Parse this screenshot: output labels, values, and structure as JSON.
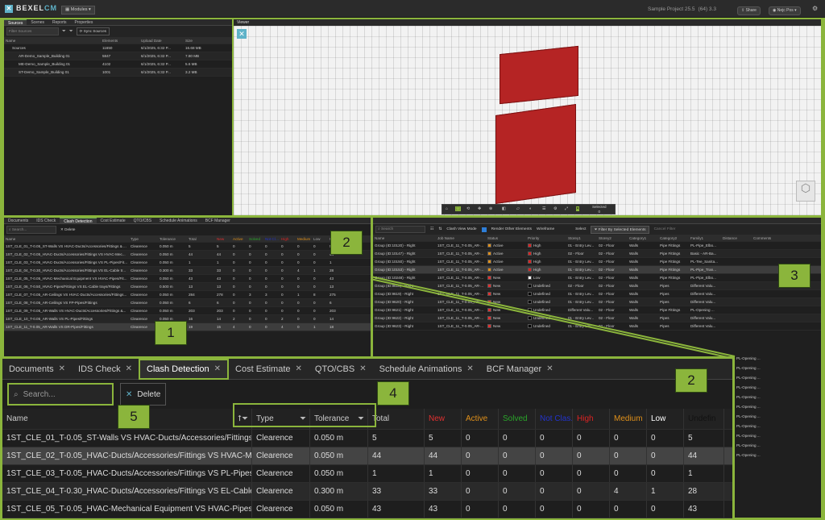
{
  "app": {
    "brand_a": "BEXEL",
    "brand_b": "CM",
    "modules": "Modules",
    "project": "Sample Project 25.5",
    "project_meta": "(64) 3.3",
    "share": "Share",
    "user": "Nejc Pos"
  },
  "left_panel": {
    "tabs": [
      "Sources",
      "Scenes",
      "Reports",
      "Properties"
    ],
    "filter_placeholder": "Filter Sources",
    "sync": "Sync Sources",
    "headers": [
      "Name",
      "Elements",
      "Upload Date",
      "Size"
    ],
    "rows": [
      [
        "Sources",
        "11650",
        "6/1/2025, 6:32 P...",
        "16.68 MB"
      ],
      [
        "AR-Demo_Sample_Building 01",
        "5847",
        "6/1/2025, 6:32 P...",
        "7.80 MB"
      ],
      [
        "ME-Demo_Sample_Building 01",
        "4102",
        "6/1/2025, 6:32 P...",
        "5.6 MB"
      ],
      [
        "ST-Demo_Sample_Building 01",
        "1001",
        "6/1/2025, 6:32 P...",
        "3.2 MB"
      ]
    ]
  },
  "viewer": {
    "title": "Viewer",
    "selected_label": "Selected",
    "selected_count": "0"
  },
  "small_clash": {
    "tabs": [
      "Documents",
      "IDS Check",
      "Clash Detection",
      "Cost Estimate",
      "QTO/CBS",
      "Schedule Animations",
      "BCF Manager"
    ],
    "search": "Search...",
    "delete": "Delete",
    "headers": [
      "Name",
      "Type",
      "Tolerance",
      "Total",
      "New",
      "Active",
      "Solved",
      "Not Clas.",
      "High",
      "Medium",
      "Low",
      "Undefined"
    ],
    "rows": [
      [
        "1ST_CLE_01_T-0.05_ST-Walls VS HVAC-Ducts/Accessories/Fittings & ...",
        "Clearence",
        "0.050 m",
        "5",
        "5",
        "0",
        "0",
        "0",
        "0",
        "0",
        "0",
        "5"
      ],
      [
        "1ST_CLE_02_T-0.05_HVAC-Ducts/Accessories/Fittings VS HVAC-Mec...",
        "Clearence",
        "0.050 m",
        "44",
        "44",
        "0",
        "0",
        "0",
        "0",
        "0",
        "0",
        "44"
      ],
      [
        "1ST_CLE_03_T-0.05_HVAC-Ducts/Accessories/Fittings VS PL-Pipes/Fit...",
        "Clearence",
        "0.050 m",
        "1",
        "1",
        "0",
        "0",
        "0",
        "0",
        "0",
        "0",
        "1"
      ],
      [
        "1ST_CLE_04_T-0.30_HVAC-Ducts/Accessories/Fittings VS EL-Cable tr...",
        "Clearence",
        "0.300 m",
        "33",
        "33",
        "0",
        "0",
        "0",
        "0",
        "4",
        "1",
        "28"
      ],
      [
        "1ST_CLE_05_T-0.05_HVAC-Mechanical Equipment VS HVAC-Pipes/Fit...",
        "Clearence",
        "0.050 m",
        "43",
        "43",
        "0",
        "0",
        "0",
        "0",
        "0",
        "0",
        "43"
      ],
      [
        "1ST_CLE_06_T-0.50_HVAC-Pipes/Fittings VS EL-Cable trays/Fittings",
        "Clearence",
        "0.500 m",
        "13",
        "13",
        "0",
        "0",
        "0",
        "0",
        "0",
        "0",
        "13"
      ],
      [
        "1ST_CLE_07_T-0.05_AR-Ceilings VS HVAC-Ducts/Accessories/Fittings...",
        "Clearence",
        "0.050 m",
        "284",
        "278",
        "0",
        "3",
        "3",
        "0",
        "1",
        "8",
        "275"
      ],
      [
        "1ST_CLE_08_T-0.05_AR-Ceilings VS FP-Pipes/Fittings",
        "Clearence",
        "0.050 m",
        "6",
        "6",
        "0",
        "0",
        "0",
        "0",
        "0",
        "0",
        "6"
      ],
      [
        "1ST_CLE_09_T-0.05_AR-Walls VS HVAC-Ducts/Accessories/Fittings &...",
        "Clearence",
        "0.050 m",
        "203",
        "203",
        "0",
        "0",
        "0",
        "0",
        "0",
        "0",
        "203"
      ],
      [
        "1ST_CLE_10_T-0.05_AR-Walls VS PL-Pipes/Fittings",
        "Clearence",
        "0.050 m",
        "16",
        "14",
        "2",
        "0",
        "0",
        "2",
        "0",
        "0",
        "14"
      ],
      [
        "1ST_CLE_11_T-0.05_AR-Walls VS DR-Pipes/Fittings",
        "Clearence",
        "0.050 m",
        "19",
        "15",
        "4",
        "0",
        "0",
        "4",
        "0",
        "1",
        "18"
      ]
    ]
  },
  "clash_results": {
    "search": "Search",
    "view_mode": "Clash View Mode",
    "render_other": "Render Other Elements",
    "wireframe": "Wireframe",
    "select": "Select",
    "filter": "Filter By Selected Elements",
    "cancel": "Cancel Filter",
    "headers": [
      "Name",
      "Job Name",
      "Status",
      "Priority",
      "Storey1",
      "Storey2",
      "Category1",
      "Category2",
      "Family1",
      "Distance",
      "Comments"
    ],
    "rows": [
      [
        "Group (ID:10120) - Right",
        "1ST_CLE_11_T-0.05_AR-...",
        "Active",
        "High",
        "01 - Entry Lev...",
        "02 - Floor",
        "Walls",
        "Pipe Fittings",
        "PL-Pipe_Elbo...",
        "",
        ""
      ],
      [
        "Group (ID:10147) - Right",
        "1ST_CLE_11_T-0.05_AR-...",
        "Active",
        "High",
        "02 - Floor",
        "02 - Floor",
        "Walls",
        "Pipe Fittings",
        "Basic - AR-Ba...",
        "",
        ""
      ],
      [
        "Group (ID:10150) - Right",
        "1ST_CLE_11_T-0.05_AR-...",
        "Active",
        "High",
        "01 - Entry Lev...",
        "02 - Floor",
        "Walls",
        "Pipe Fittings",
        "PL-Tee_Sanita...",
        "",
        ""
      ],
      [
        "Group (ID:10153) - Right",
        "1ST_CLE_11_T-0.05_AR-...",
        "Active",
        "High",
        "01 - Entry Lev...",
        "02 - Floor",
        "Walls",
        "Pipe Fittings",
        "PL-Pipe_Tran...",
        "",
        ""
      ],
      [
        "Group (ID:10248) - Right",
        "1ST_CLE_11_T-0.05_AR-...",
        "New",
        "Low",
        "01 - Entry Lev...",
        "02 - Floor",
        "Walls",
        "Pipe Fittings",
        "PL-Pipe_Elbo...",
        "",
        ""
      ],
      [
        "Group (ID:9618) - Right",
        "1ST_CLE_11_T-0.05_AR-...",
        "New",
        "Undefined",
        "02 - Floor",
        "02 - Floor",
        "Walls",
        "Pipes",
        "Different Valu...",
        "",
        ""
      ],
      [
        "Group (ID:9619) - Right",
        "1ST_CLE_11_T-0.05_AR-...",
        "New",
        "Undefined",
        "01 - Entry Lev...",
        "02 - Floor",
        "Walls",
        "Pipes",
        "Different Valu...",
        "",
        ""
      ],
      [
        "Group (ID:9620) - Right",
        "1ST_CLE_11_T-0.05_AR-...",
        "New",
        "Undefined",
        "01 - Entry Lev...",
        "02 - Floor",
        "Walls",
        "Pipes",
        "Different Valu...",
        "",
        ""
      ],
      [
        "Group (ID:9621) - Right",
        "1ST_CLE_11_T-0.05_AR-...",
        "New",
        "Undefined",
        "Different Valu...",
        "02 - Floor",
        "Walls",
        "Pipe Fittings",
        "PL-Opening ...",
        "",
        ""
      ],
      [
        "Group (ID:9622) - Right",
        "1ST_CLE_11_T-0.05_AR-...",
        "New",
        "Undefined",
        "01 - Entry Lev...",
        "02 - Floor",
        "Walls",
        "Pipes",
        "Different Valu...",
        "",
        ""
      ],
      [
        "Group (ID:9623) - Right",
        "1ST_CLE_11_T-0.05_AR-...",
        "New",
        "Undefined",
        "01 - Entry Lev...",
        "02 - Floor",
        "Walls",
        "Pipes",
        "Different Valu...",
        "",
        ""
      ]
    ],
    "extra": [
      "PL-Opening ...",
      "PL-Opening ...",
      "PL-Opening ...",
      "PL-Opening ...",
      "PL-Opening ...",
      "PL-Opening ...",
      "PL-Opening ...",
      "PL-Opening ...",
      "PL-Opening ...",
      "PL-Opening ...",
      "PL-Opening ..."
    ]
  },
  "zoom": {
    "tabs": [
      "Documents",
      "IDS Check",
      "Clash Detection",
      "Cost Estimate",
      "QTO/CBS",
      "Schedule Animations",
      "BCF Manager"
    ],
    "search": "Search...",
    "delete": "Delete",
    "headers": [
      "Name",
      "Type",
      "Tolerance",
      "Total",
      "New",
      "Active",
      "Solved",
      "Not Clas.",
      "High",
      "Medium",
      "Low",
      "Undefin"
    ],
    "rows": [
      [
        "1ST_CLE_01_T-0.05_ST-Walls VS HVAC-Ducts/Accessories/Fittings & ...",
        "Clearence",
        "0.050 m",
        "5",
        "5",
        "0",
        "0",
        "0",
        "0",
        "0",
        "0",
        "5"
      ],
      [
        "1ST_CLE_02_T-0.05_HVAC-Ducts/Accessories/Fittings VS HVAC-Mec...",
        "Clearence",
        "0.050 m",
        "44",
        "44",
        "0",
        "0",
        "0",
        "0",
        "0",
        "0",
        "44"
      ],
      [
        "1ST_CLE_03_T-0.05_HVAC-Ducts/Accessories/Fittings VS PL-Pipes/Fi...",
        "Clearence",
        "0.050 m",
        "1",
        "1",
        "0",
        "0",
        "0",
        "0",
        "0",
        "0",
        "1"
      ],
      [
        "1ST_CLE_04_T-0.30_HVAC-Ducts/Accessories/Fittings VS EL-Cable tr...",
        "Clearence",
        "0.300 m",
        "33",
        "33",
        "0",
        "0",
        "0",
        "0",
        "4",
        "1",
        "28"
      ],
      [
        "1ST_CLE_05_T-0.05_HVAC-Mechanical Equipment VS HVAC-Pipes/Fit...",
        "Clearence",
        "0.050 m",
        "43",
        "43",
        "0",
        "0",
        "0",
        "0",
        "0",
        "0",
        "43"
      ]
    ]
  },
  "callouts": [
    "1",
    "2",
    "2",
    "3",
    "4",
    "5"
  ],
  "colors": {
    "accent": "#8bb53c",
    "new": "#e03030",
    "active": "#e0901a",
    "solved": "#2aa52a",
    "notclas": "#2233cc",
    "high": "#dd2222",
    "medium": "#e0901a",
    "low": "#ffffff",
    "undef": "#000000"
  }
}
